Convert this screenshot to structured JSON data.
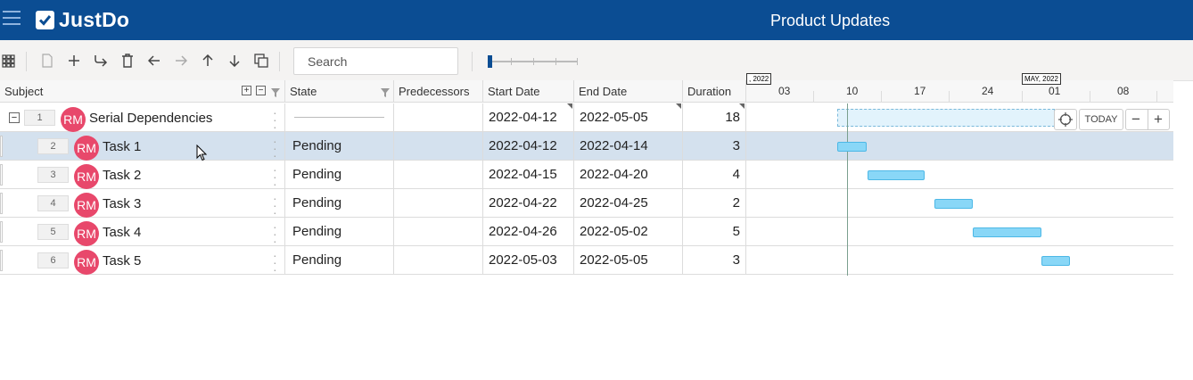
{
  "app": {
    "logo_text": "JustDo",
    "page_title": "Product Updates"
  },
  "toolbar": {
    "search_placeholder": "Search",
    "icons": [
      "grid-view-icon",
      "new-doc-icon",
      "add-icon",
      "indent-icon",
      "trash-icon",
      "arrow-left-icon",
      "arrow-right-icon",
      "arrow-up-icon",
      "arrow-down-icon",
      "duplicate-icon"
    ],
    "zoom_level": 0
  },
  "columns": {
    "subject": "Subject",
    "state": "State",
    "predecessors": "Predecessors",
    "start_date": "Start Date",
    "end_date": "End Date",
    "duration": "Duration"
  },
  "timeline": {
    "flag_left": ", 2022",
    "flag_month": "MAY, 2022",
    "labels": [
      "03",
      "10",
      "17",
      "24",
      "01",
      "08"
    ],
    "today_label": "TODAY",
    "zoom_out": "−",
    "zoom_in": "+"
  },
  "rows": [
    {
      "seq": "1",
      "avatar": "RM",
      "subject": "Serial Dependencies",
      "state": "",
      "predecessors": "",
      "start": "2022-04-12",
      "end": "2022-05-05",
      "duration": "18"
    },
    {
      "seq": "2",
      "avatar": "RM",
      "subject": "Task 1",
      "state": "Pending",
      "predecessors": "",
      "start": "2022-04-12",
      "end": "2022-04-14",
      "duration": "3"
    },
    {
      "seq": "3",
      "avatar": "RM",
      "subject": "Task 2",
      "state": "Pending",
      "predecessors": "",
      "start": "2022-04-15",
      "end": "2022-04-20",
      "duration": "4"
    },
    {
      "seq": "4",
      "avatar": "RM",
      "subject": "Task 3",
      "state": "Pending",
      "predecessors": "",
      "start": "2022-04-22",
      "end": "2022-04-25",
      "duration": "2"
    },
    {
      "seq": "5",
      "avatar": "RM",
      "subject": "Task 4",
      "state": "Pending",
      "predecessors": "",
      "start": "2022-04-26",
      "end": "2022-05-02",
      "duration": "5"
    },
    {
      "seq": "6",
      "avatar": "RM",
      "subject": "Task 5",
      "state": "Pending",
      "predecessors": "",
      "start": "2022-05-03",
      "end": "2022-05-05",
      "duration": "3"
    }
  ],
  "colors": {
    "header": "#0b4d93",
    "avatar": "#e8486b",
    "gantt_bar": "#89d7f7",
    "selected_row": "#d4e1ee"
  }
}
